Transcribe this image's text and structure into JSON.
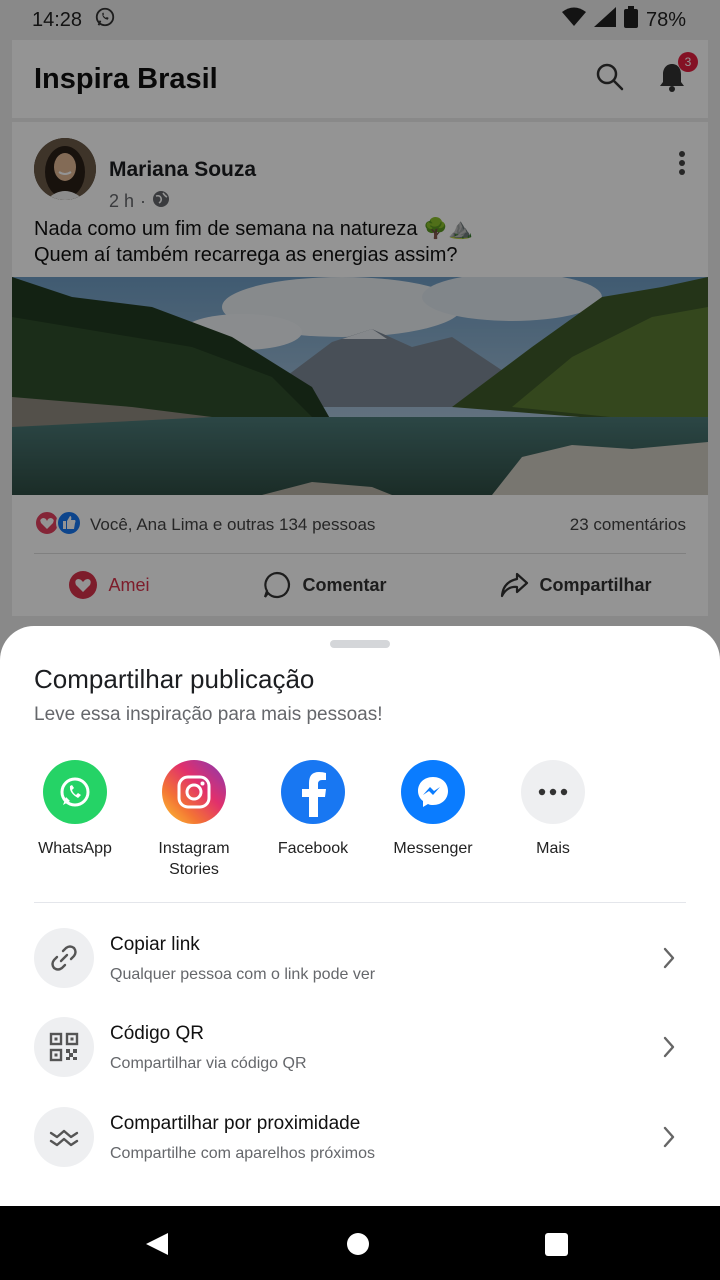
{
  "status_bar": {
    "time": "14:28",
    "battery": "78%"
  },
  "app_bar": {
    "title": "Inspira Brasil",
    "notification_count": "3"
  },
  "post": {
    "author": "Mariana Souza",
    "time": "2 h",
    "separator": "·",
    "text_line1": "Nada como um fim de semana na natureza 🌳⛰️",
    "text_line2": "Quem aí também recarrega as energias assim?",
    "reactions_text": "Você, Ana Lima e outras 134 pessoas",
    "comments_count": "23 comentários",
    "actions": {
      "love": "Amei",
      "comment": "Comentar",
      "share": "Compartilhar"
    }
  },
  "share_sheet": {
    "title": "Compartilhar publicação",
    "subtitle": "Leve essa inspiração para mais pessoas!",
    "apps": [
      {
        "label": "WhatsApp",
        "icon": "whatsapp-icon",
        "color": "#25d366"
      },
      {
        "label_line1": "Instagram",
        "label_line2": "Stories",
        "icon": "instagram-icon",
        "color": "#e1306c"
      },
      {
        "label": "Facebook",
        "icon": "facebook-icon",
        "color": "#1877f2"
      },
      {
        "label": "Messenger",
        "icon": "messenger-icon",
        "color": "#0a7cff"
      },
      {
        "label": "Mais",
        "icon": "more-icon",
        "color": "#eeeff1"
      }
    ],
    "options": [
      {
        "title": "Copiar link",
        "subtitle": "Qualquer pessoa com o link pode ver",
        "icon": "link-icon"
      },
      {
        "title": "Código QR",
        "subtitle": "Compartilhar via código QR",
        "icon": "qr-code-icon"
      },
      {
        "title": "Compartilhar por proximidade",
        "subtitle": "Compartilhe com aparelhos próximos",
        "icon": "nearby-share-icon"
      }
    ]
  },
  "colors": {
    "love": "#d8324a",
    "like": "#1877f2",
    "badge": "#e41e3f"
  }
}
